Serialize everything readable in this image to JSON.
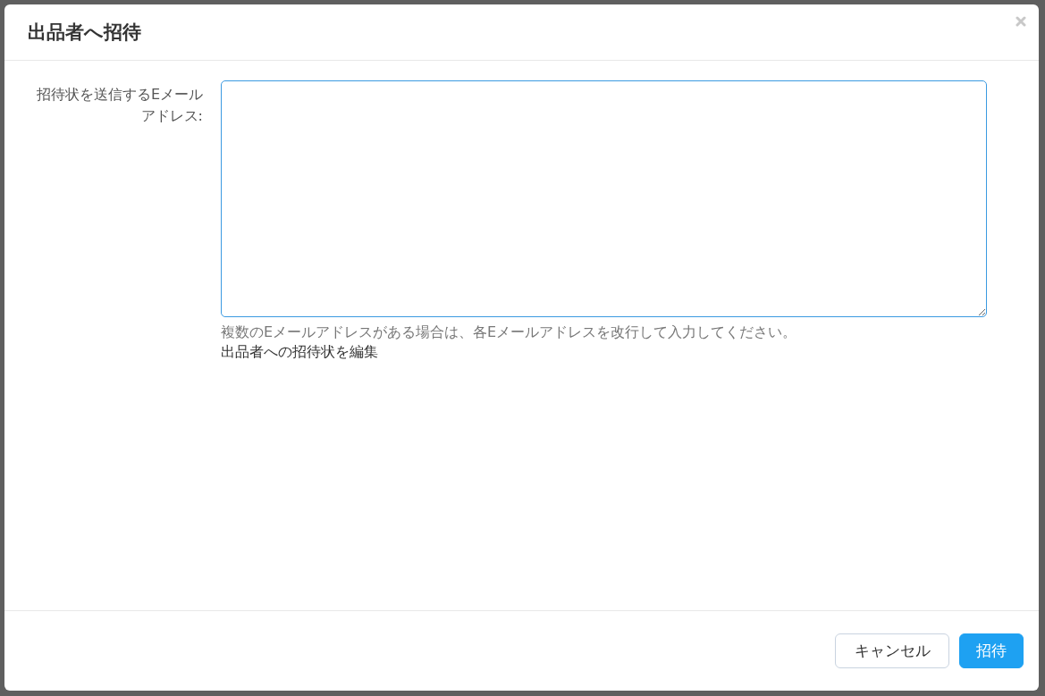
{
  "dialog": {
    "title": "出品者へ招待",
    "field": {
      "label": "招待状を送信するEメールアドレス:",
      "focused": true
    },
    "help_text": "複数のEメールアドレスがある場合は、各Eメールアドレスを改行して入力してください。",
    "link": "出品者への招待状を編集",
    "buttons": [
      {
        "label": "キャンセル",
        "kind": "secondary"
      },
      {
        "label": "招待",
        "kind": "primary"
      }
    ]
  }
}
